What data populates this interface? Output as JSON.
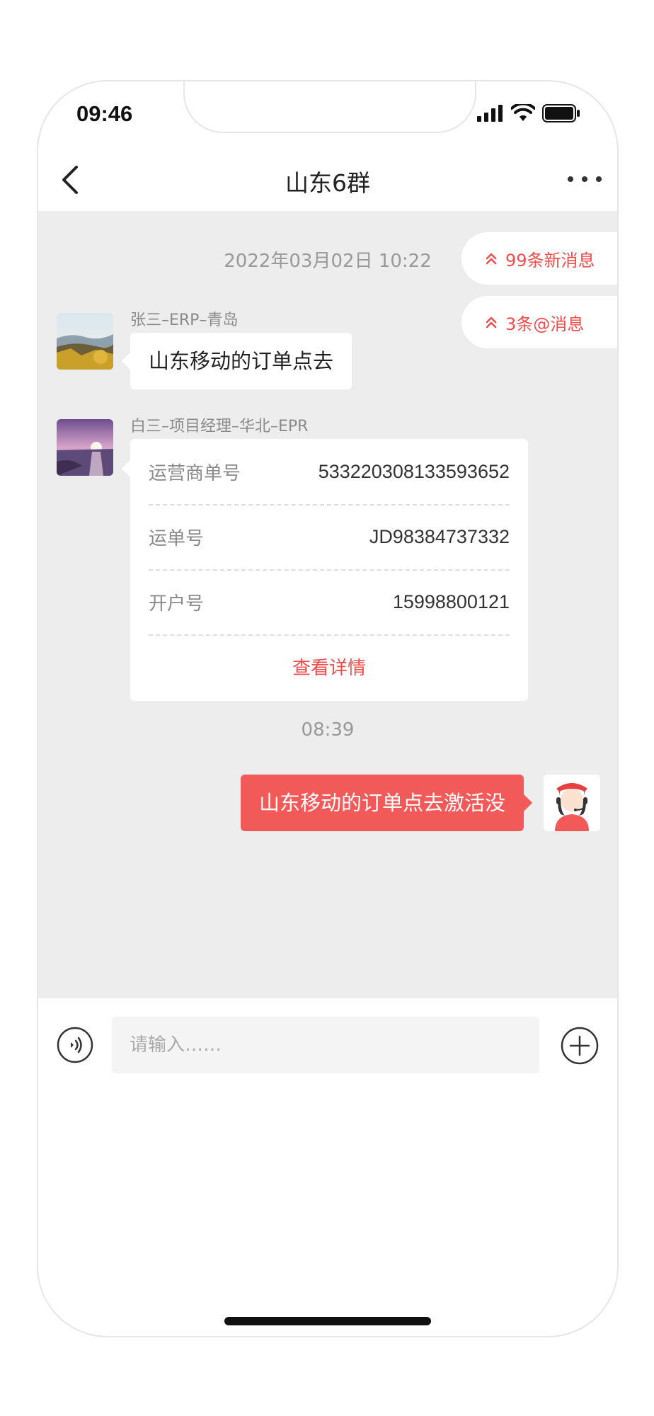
{
  "status": {
    "time": "09:46"
  },
  "header": {
    "title": "山东6群"
  },
  "chat": {
    "timestamp1": "2022年03月02日 10:22",
    "new_messages": "99条新消息",
    "at_messages": "3条@消息",
    "msg1": {
      "sender": "张三–ERP–青岛",
      "text": "山东移动的订单点去"
    },
    "msg2": {
      "sender": "白三–项目经理–华北–EPR",
      "rows": [
        {
          "label": "运营商单号",
          "value": "533220308133593652"
        },
        {
          "label": "运单号",
          "value": "JD98384737332"
        },
        {
          "label": "开户号",
          "value": "15998800121"
        }
      ],
      "link": "查看详情"
    },
    "timestamp2": "08:39",
    "msg3": {
      "text": "山东移动的订单点去激活没"
    }
  },
  "input": {
    "placeholder": "请输入……"
  },
  "colors": {
    "accent": "#f25a5a",
    "link": "#f04d4d",
    "chat_bg": "#ededed"
  }
}
